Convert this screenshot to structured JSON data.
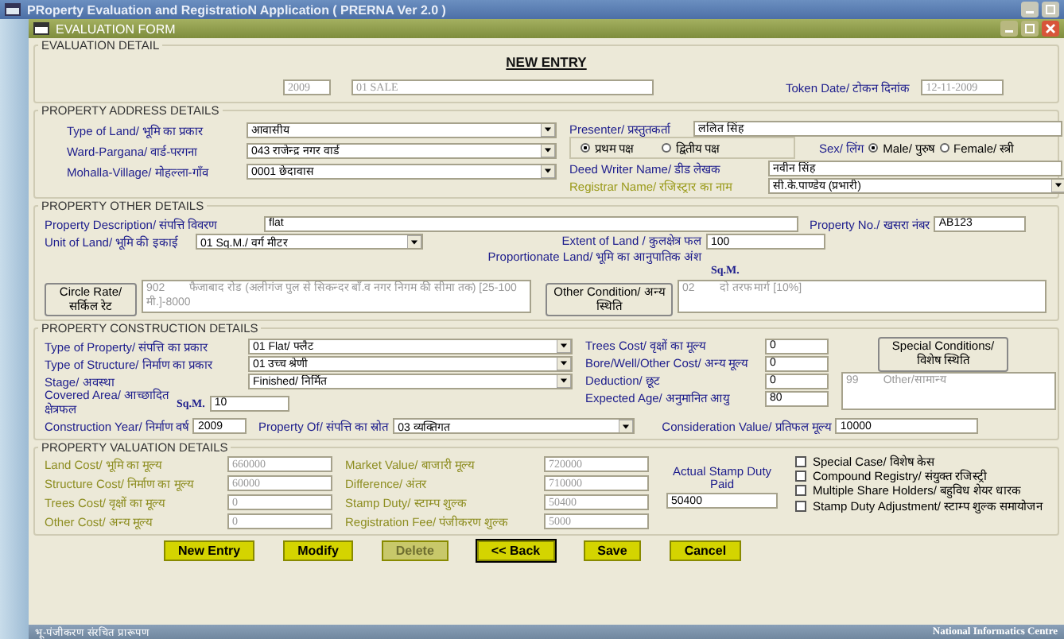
{
  "app_title": "PRoperty Evaluation and RegistratioN Application ( PRERNA Ver 2.0 )",
  "form_title": "EVALUATION FORM",
  "evaluation_detail": {
    "legend": "EVALUATION DETAIL",
    "heading": "NEW ENTRY",
    "year": {
      "value": "2009",
      "kind": "readonly"
    },
    "deed_type": {
      "value": "01 SALE",
      "kind": "readonly"
    },
    "token_date": {
      "label": "Token Date/ टोकन दिनांक",
      "value": "12-11-2009",
      "kind": "readonly"
    }
  },
  "address": {
    "legend": "PROPERTY ADDRESS DETAILS",
    "left": [
      {
        "label": "Type of Land/ भूमि का प्रकार",
        "value": "आवासीय",
        "kind": "select",
        "color": "#1c1c8c"
      },
      {
        "label": "Ward-Pargana/ वार्ड-परगना",
        "value": "043 राजेन्द्र नगर वार्ड",
        "kind": "select",
        "color": "#1c1c8c"
      },
      {
        "label": "Mohalla-Village/ मोहल्ला-गाँव",
        "value": "0001 छेदावास",
        "kind": "select",
        "color": "#1c1c8c"
      }
    ],
    "presenter": {
      "label": "Presenter/ प्रस्तुतकर्ता",
      "value": "ललित सिंह",
      "kind": "text",
      "color": "#1c1c8c"
    },
    "party": [
      {
        "label": "प्रथम पक्ष",
        "selected": true
      },
      {
        "label": "द्वितीय पक्ष",
        "selected": false
      }
    ],
    "sex_label": "Sex/ लिंग",
    "sex": [
      {
        "label": "Male/ पुरुष",
        "selected": true
      },
      {
        "label": "Female/ स्त्री",
        "selected": false
      }
    ],
    "deed_writer": {
      "label": "Deed Writer Name/ डीड लेखक",
      "value": "नवीन सिंह",
      "kind": "text",
      "color": "#1c1c8c"
    },
    "registrar": {
      "label": "Registrar Name/ रजिस्ट्रार का नाम",
      "value": "सी.के.पाण्डेय (प्रभारी)",
      "kind": "select",
      "color": "#9a9a1a"
    }
  },
  "other": {
    "legend": "PROPERTY OTHER DETAILS",
    "description": {
      "label": "Property Description/ संपत्ति विवरण",
      "value": "flat",
      "kind": "text"
    },
    "property_no": {
      "label": "Property No./ खसरा नंबर",
      "value": "AB123",
      "kind": "text"
    },
    "unit": {
      "label": "Unit of Land/ भूमि की इकाई",
      "value": "01 Sq.M./ वर्ग मीटर",
      "kind": "select"
    },
    "extent": {
      "label": "Extent of Land / कुलक्षेत्र फल",
      "value": "100",
      "kind": "text"
    },
    "proportionate_label": "Proportionate Land/ भूमि का आनुपातिक अंश",
    "unit_note": "Sq.M.",
    "circle_rate_button": "Circle Rate/ सर्किल रेट",
    "circle_rate": {
      "value": "902        फैजाबाद रोड (अलीगंज पुल से सिकन्दर बाँ.व नगर निगम की सीमा तक) [25-100 मी.]-8000",
      "kind": "readonly"
    },
    "other_condition_button": "Other Condition/ अन्य स्थिति",
    "other_condition": {
      "value": "02        दो तरफ मार्ग [10%]",
      "kind": "readonly"
    }
  },
  "construction": {
    "legend": "PROPERTY CONSTRUCTION DETAILS",
    "left": [
      {
        "label": "Type of Property/ संपत्ति का प्रकार",
        "value": "01 Flat/ फ्लैट",
        "kind": "select"
      },
      {
        "label": "Type of Structure/ निर्माण का प्रकार",
        "value": "01  उच्च श्रेणी",
        "kind": "select"
      },
      {
        "label": "Stage/ अवस्था",
        "value": "Finished/ निर्मित",
        "kind": "select"
      }
    ],
    "covered_area": {
      "label": "Covered Area/ आच्छादित क्षेत्रफल",
      "value": "10",
      "kind": "text"
    },
    "unit_note": "Sq.M.",
    "middle": [
      {
        "label": "Trees Cost/ वृक्षों का मूल्य",
        "value": "0",
        "kind": "text"
      },
      {
        "label": "Bore/Well/Other Cost/ अन्य मूल्य",
        "value": "0",
        "kind": "text"
      },
      {
        "label": "Deduction/ छूट",
        "value": "0",
        "kind": "text"
      },
      {
        "label": "Expected Age/ अनुमानित आयु",
        "value": "80",
        "kind": "text"
      }
    ],
    "special_button": "Special Conditions/ विशेष स्थिति",
    "special_conditions": {
      "value": "99        Other/सामान्य",
      "kind": "readonly"
    },
    "construction_year": {
      "label": "Construction Year/ निर्माण वर्ष",
      "value": "2009",
      "kind": "text"
    },
    "property_of": {
      "label": "Property Of/ संपत्ति का स्रोत",
      "value": "03    व्यक्तिगत",
      "kind": "select"
    },
    "consideration": {
      "label": "Consideration Value/ प्रतिफल मूल्य",
      "value": "10000",
      "kind": "text"
    }
  },
  "valuation": {
    "legend": "PROPERTY VALUATION DETAILS",
    "col1": [
      {
        "label": "Land Cost/ भूमि का मूल्य",
        "value": "660000",
        "kind": "readonly"
      },
      {
        "label": "Structure Cost/ निर्माण का मूल्य",
        "value": "60000",
        "kind": "readonly"
      },
      {
        "label": "Trees Cost/ वृक्षों का मूल्य",
        "value": "0",
        "kind": "readonly"
      },
      {
        "label": "Other Cost/ अन्य मूल्य",
        "value": "0",
        "kind": "readonly"
      }
    ],
    "col2": [
      {
        "label": "Market Value/ बाजारी मूल्य",
        "value": "720000",
        "kind": "readonly"
      },
      {
        "label": "Difference/ अंतर",
        "value": "710000",
        "kind": "readonly"
      },
      {
        "label": "Stamp Duty/ स्टाम्प शुल्क",
        "value": "50400",
        "kind": "readonly"
      },
      {
        "label": "Registration Fee/ पंजीकरण शुल्क",
        "value": "5000",
        "kind": "readonly"
      }
    ],
    "actual_label": "Actual Stamp Duty Paid",
    "actual": {
      "value": "50400",
      "kind": "text"
    },
    "options": [
      {
        "label": "Special Case/ विशेष केस",
        "checked": false
      },
      {
        "label": "Compound Registry/ संयुक्त रजिस्ट्री",
        "checked": false
      },
      {
        "label": "Multiple Share Holders/ बहुविध शेयर धारक",
        "checked": false
      },
      {
        "label": "Stamp Duty Adjustment/ स्टाम्प शुल्क समायोजन",
        "checked": false
      }
    ]
  },
  "buttons": [
    {
      "label": "New Entry",
      "disabled": false,
      "focused": false
    },
    {
      "label": "Modify",
      "disabled": false,
      "focused": false
    },
    {
      "label": "Delete",
      "disabled": true,
      "focused": false
    },
    {
      "label": "<< Back",
      "disabled": false,
      "focused": true
    },
    {
      "label": "Save",
      "disabled": false,
      "focused": false
    },
    {
      "label": "Cancel",
      "disabled": false,
      "focused": false
    }
  ],
  "status_bar": {
    "left": "भू-पंजीकरण संरचित प्रारूपण",
    "right": "National Informatics Centre"
  }
}
